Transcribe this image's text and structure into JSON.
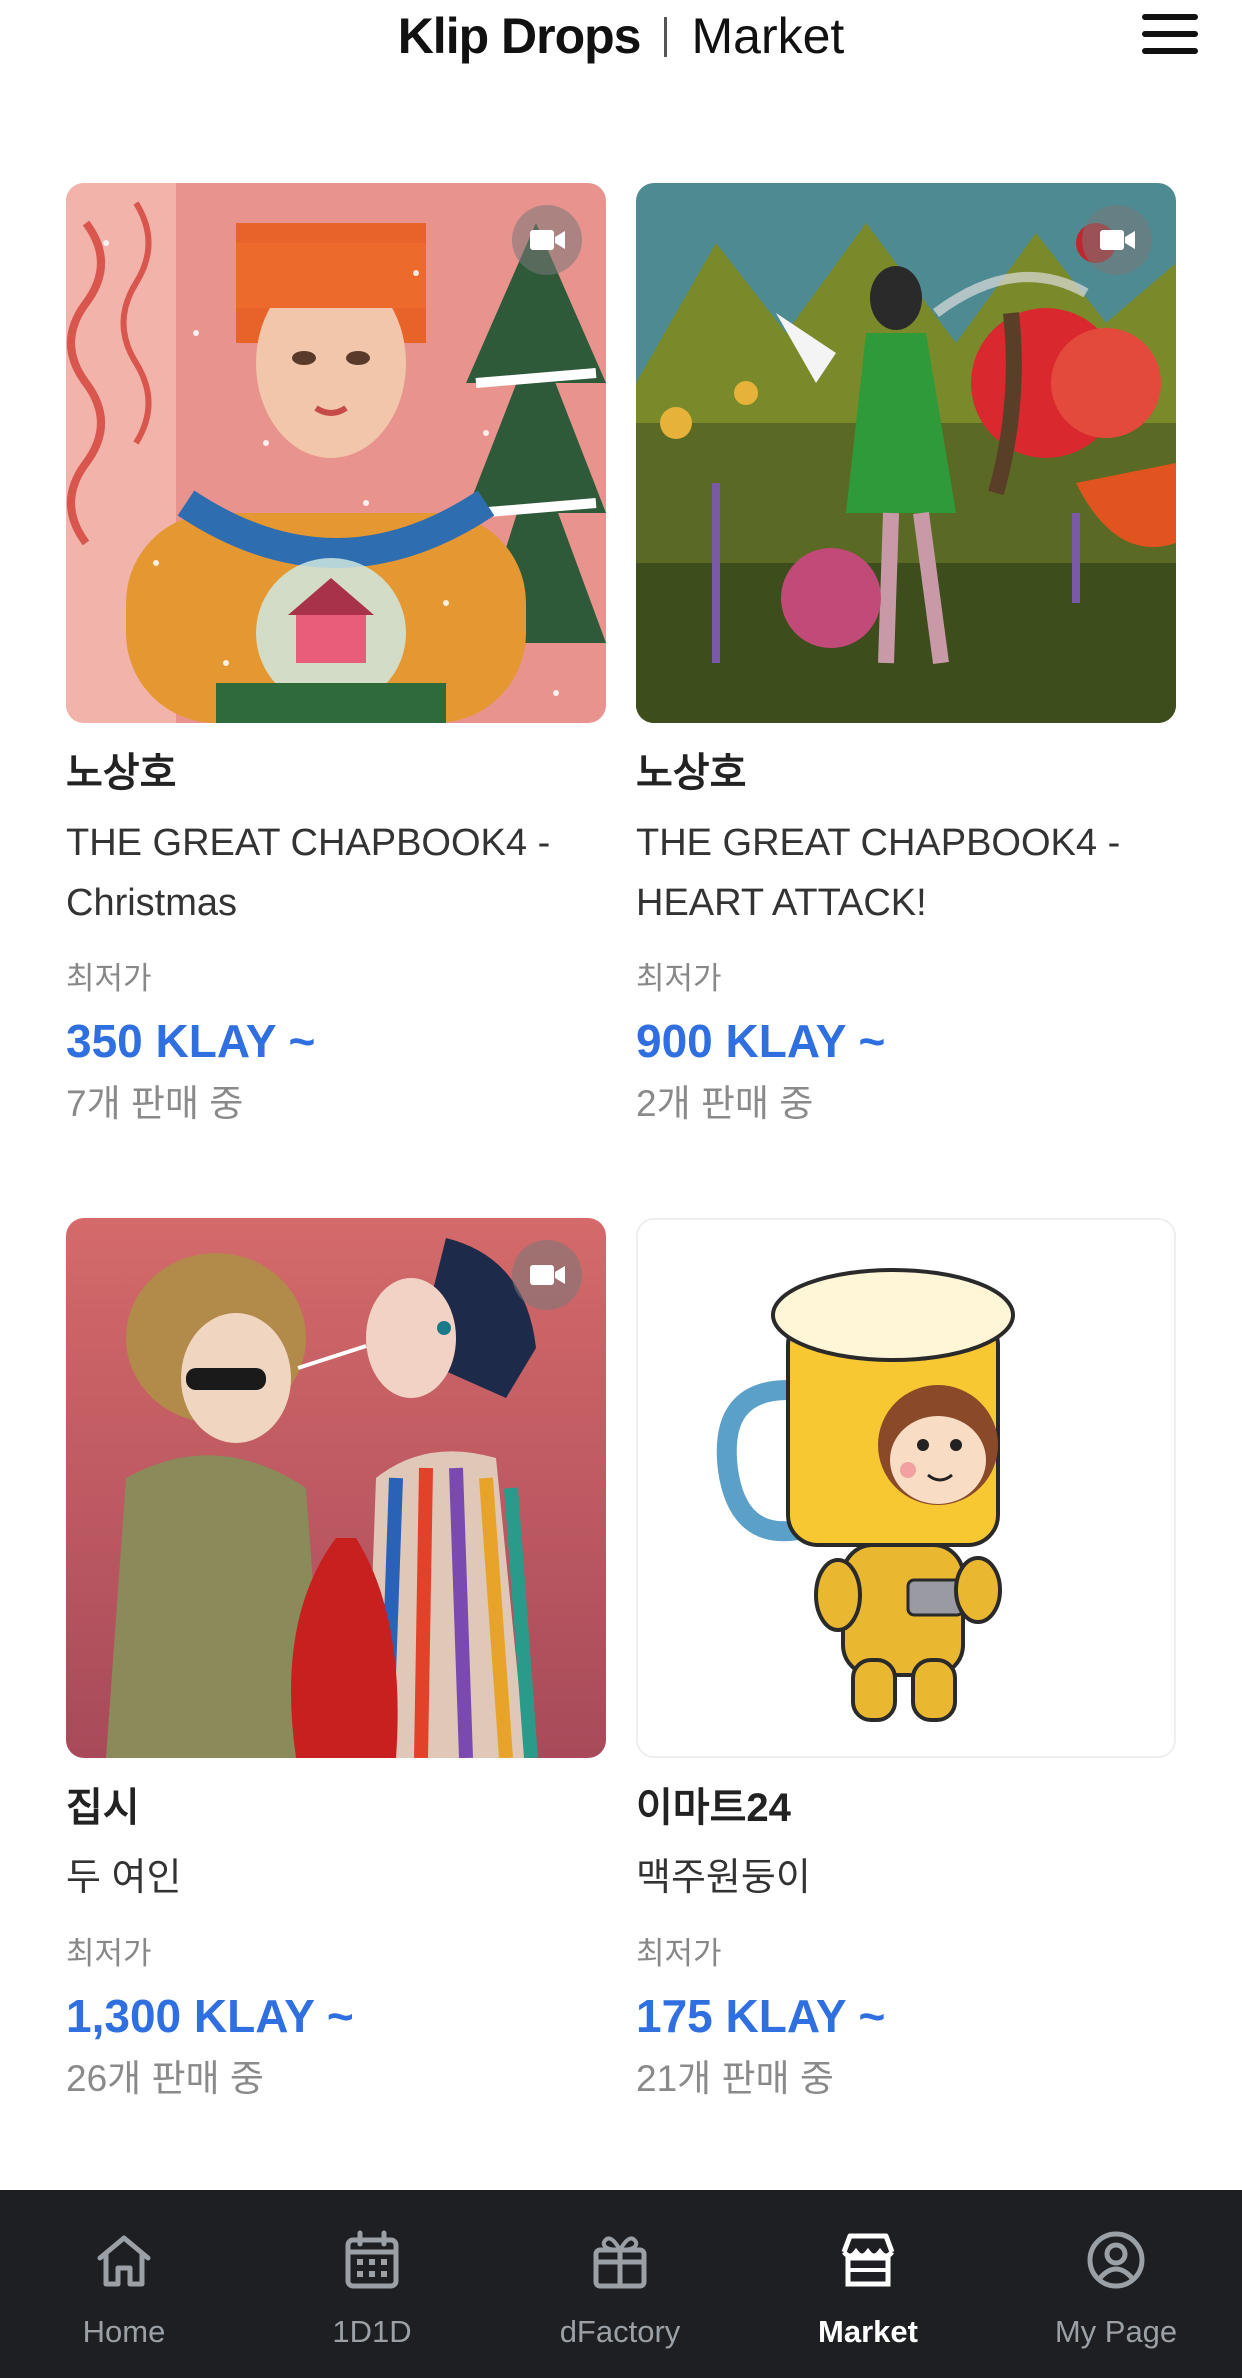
{
  "header": {
    "logo": "Klip Drops",
    "section": "Market"
  },
  "items": [
    {
      "artist": "노상호",
      "title": "THE GREAT CHAPBOOK4 - Christmas",
      "price_label": "최저가",
      "price": "350 KLAY ~",
      "count": "7개 판매 중",
      "has_video": true
    },
    {
      "artist": "노상호",
      "title": "THE GREAT CHAPBOOK4 - HEART ATTACK!",
      "price_label": "최저가",
      "price": "900 KLAY ~",
      "count": "2개 판매 중",
      "has_video": true
    },
    {
      "artist": "집시",
      "title": "두 여인",
      "price_label": "최저가",
      "price": "1,300 KLAY ~",
      "count": "26개 판매 중",
      "has_video": true
    },
    {
      "artist": "이마트24",
      "title": "맥주원둥이",
      "price_label": "최저가",
      "price": "175 KLAY ~",
      "count": "21개 판매 중",
      "has_video": false
    }
  ],
  "tabbar": {
    "tabs": [
      {
        "label": "Home",
        "icon": "home-icon"
      },
      {
        "label": "1D1D",
        "icon": "calendar-icon"
      },
      {
        "label": "dFactory",
        "icon": "gift-icon"
      },
      {
        "label": "Market",
        "icon": "store-icon",
        "active": true
      },
      {
        "label": "My Page",
        "icon": "user-circle-icon"
      }
    ]
  },
  "colors": {
    "accent": "#2f6fe0",
    "tabbar_bg": "#1d1f22"
  }
}
